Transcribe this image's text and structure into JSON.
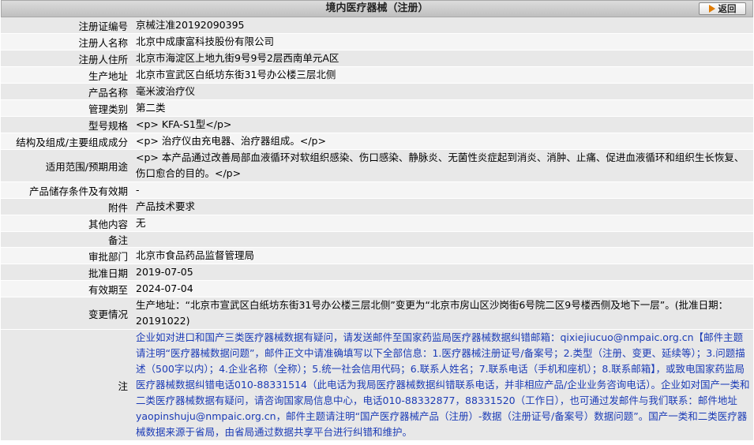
{
  "header": {
    "title": "境内医疗器械（注册）",
    "back_label": "返回"
  },
  "rows": [
    {
      "label": "注册证编号",
      "value": "京械注准20192090395"
    },
    {
      "label": "注册人名称",
      "value": "北京中成康富科技股份有限公司"
    },
    {
      "label": "注册人住所",
      "value": "北京市海淀区上地九街9号9号2层西南单元A区"
    },
    {
      "label": "生产地址",
      "value": "北京市宣武区白纸坊东街31号办公楼三层北侧"
    },
    {
      "label": "产品名称",
      "value": "毫米波治疗仪"
    },
    {
      "label": "管理类别",
      "value": "第二类"
    },
    {
      "label": "型号规格",
      "value": "<p> KFA-S1型</p>"
    },
    {
      "label": "结构及组成/主要组成成分",
      "value": "<p> 治疗仪由充电器、治疗器组成。</p>"
    },
    {
      "label": "适用范围/预期用途",
      "value": "<p> 本产品通过改善局部血液循环对软组织感染、伤口感染、静脉炎、无菌性炎症起到消炎、消肿、止痛、促进血液循环和组织生长恢复、伤口愈合的目的。</p>"
    },
    {
      "label": "产品储存条件及有效期",
      "value": "-"
    },
    {
      "label": "附件",
      "value": "产品技术要求"
    },
    {
      "label": "其他内容",
      "value": "无"
    },
    {
      "label": "备注",
      "value": ""
    },
    {
      "label": "审批部门",
      "value": "北京市食品药品监督管理局"
    },
    {
      "label": "批准日期",
      "value": "2019-07-05"
    },
    {
      "label": "有效期至",
      "value": "2024-07-04"
    },
    {
      "label": "变更情况",
      "value": "生产地址：“北京市宣武区白纸坊东街31号办公楼三层北侧”变更为“北京市房山区沙岗街6号院二区9号楼西侧及地下一层”。(批准日期：20191022)"
    }
  ],
  "note": {
    "label": "注",
    "text": "企业如对进口和国产三类医疗器械数据有疑问，请发送邮件至国家药监局医疗器械数据纠错邮箱：qixiejiucuo@nmpaic.org.cn【邮件主题请注明“医疗器械数据问题”，邮件正文中请准确填写以下全部信息：1.医疗器械注册证号/备案号；2.类型（注册、变更、延续等）；3.问题描述（500字以内）；4.企业名称（全称）；5.统一社会信用代码；6.联系人姓名；7.联系电话（手机和座机）；8.联系邮箱】，或致电国家药监局医疗器械数据纠错电话010-88331514（此电话为我局医疗器械数据纠错联系电话，并非相应产品/企业业务咨询电话）。企业如对国产一类和二类医疗器械数据有疑问，请咨询国家局信息中心，电话010-88332877，88331520（工作日），也可通过发邮件与我们联系：邮件地址yaopinshuju@nmpaic.org.cn，邮件主题请注明“国产医疗器械产品（注册）-数据（注册证号/备案号）数据问题”。国产一类和二类医疗器械数据来源于省局，由省局通过数据共享平台进行纠错和维护。"
  }
}
